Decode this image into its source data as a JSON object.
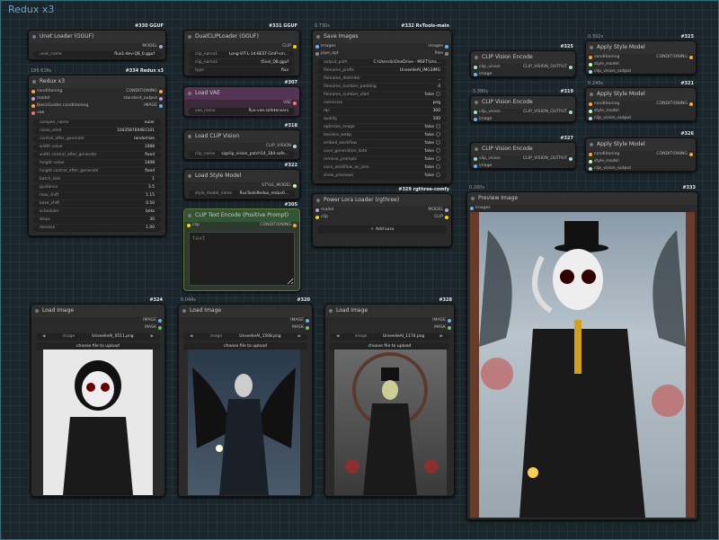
{
  "group": {
    "title": "Redux x3"
  },
  "nodes": {
    "unet": {
      "id": "#330 GGUF",
      "title": "Unet Loader (GGUF)",
      "out": "MODEL",
      "w_label": "unet_name",
      "w_value": "flux1-dev-Q8_0.gguf"
    },
    "redux": {
      "id": "#334 Redux x3",
      "time": "186.616s",
      "title": "Redux x3",
      "inputs": [
        "conditioning",
        "model",
        "BasicGuider conditioning",
        "vae"
      ],
      "outputs": [
        "CONDITIONING",
        "standard_output",
        "IMAGE"
      ],
      "widgets": [
        [
          "sampler_name",
          "euler"
        ],
        [
          "noise_seed",
          "104358760481101"
        ],
        [
          "control_after_generate",
          "randomize"
        ],
        [
          "width value",
          "1088"
        ],
        [
          "width control_after_generate",
          "fixed"
        ],
        [
          "height value",
          "1408"
        ],
        [
          "height control_after_generate",
          "fixed"
        ],
        [
          "batch_size",
          "1"
        ],
        [
          "guidance",
          "3.5"
        ],
        [
          "max_shift",
          "1.15"
        ],
        [
          "base_shift",
          "0.50"
        ],
        [
          "scheduler",
          "beta"
        ],
        [
          "steps",
          "30"
        ],
        [
          "denoise",
          "1.00"
        ]
      ]
    },
    "dualclip": {
      "id": "#331 GGUF",
      "title": "DualCLIPLoader (GGUF)",
      "out": "CLIP",
      "widgets": [
        [
          "clip_name1",
          "Long-ViT-L-14-BEST-GmP-sm..."
        ],
        [
          "clip_name2",
          "t5xxl_Q8.gguf"
        ],
        [
          "type",
          "flux"
        ]
      ]
    },
    "vae": {
      "id": "#307",
      "title": "Load VAE",
      "out": "VAE",
      "w_label": "vae_name",
      "w_value": "flux-vae.safetensors"
    },
    "clipvision": {
      "id": "#318",
      "title": "Load CLIP Vision",
      "out": "CLIP_VISION",
      "w_label": "clip_name",
      "w_value": "sigclip_vision_patch14_384.safe..."
    },
    "stylemodel": {
      "id": "#322",
      "title": "Load Style Model",
      "out": "STYLE_MODEL",
      "w_label": "style_model_name",
      "w_value": "fluxToolsRedux_redux0..."
    },
    "clipenc": {
      "id": "#305",
      "title": "CLIP Text Encode (Positive Prompt)",
      "in": "clip",
      "out": "CONDITIONING",
      "placeholder": "text"
    },
    "save": {
      "id": "#332 RvTools-main",
      "time": "0.730s",
      "title": "Save Images",
      "inputs": [
        "images",
        "pipe_opt"
      ],
      "outputs": [
        "images",
        "files"
      ],
      "widgets": [
        [
          "output_path",
          "C:\\Users\\k\\OneDrive - MSFT\\Uns..."
        ],
        [
          "filename_prefix",
          "UnseelieAI_IMG3IMG"
        ],
        [
          "filename_delimiter",
          "_"
        ],
        [
          "filename_number_padding",
          "4"
        ],
        [
          "filename_number_start",
          "false"
        ],
        [
          "extension",
          "png"
        ],
        [
          "dpi",
          "300"
        ],
        [
          "quality",
          "100"
        ],
        [
          "optimize_image",
          "false"
        ],
        [
          "lossless_webp",
          "false"
        ],
        [
          "embed_workflow",
          "false"
        ],
        [
          "save_generation_data",
          "false"
        ],
        [
          "remove_prompts",
          "false"
        ],
        [
          "save_workflow_as_json",
          "false"
        ],
        [
          "show_previews",
          "false"
        ]
      ]
    },
    "lora": {
      "id": "#329 rgthree-comfy",
      "title": "Power Lora Loader (rgthree)",
      "inputs": [
        "model",
        "clip"
      ],
      "outputs": [
        "MODEL",
        "CLIP"
      ],
      "button": "Add Lora"
    },
    "cve1": {
      "id": "#325",
      "title": "CLIP Vision Encode",
      "inputs": [
        "clip_vision",
        "image"
      ],
      "out": "CLIP_VISION_OUTPUT"
    },
    "cve2": {
      "id": "#319",
      "time": "0.380s",
      "title": "CLIP Vision Encode",
      "inputs": [
        "clip_vision",
        "image"
      ],
      "out": "CLIP_VISION_OUTPUT"
    },
    "cve3": {
      "id": "#327",
      "title": "CLIP Vision Encode",
      "inputs": [
        "clip_vision",
        "image"
      ],
      "out": "CLIP_VISION_OUTPUT"
    },
    "asm1": {
      "id": "#323",
      "time": "0.302s",
      "title": "Apply Style Model",
      "inputs": [
        "conditioning",
        "style_model",
        "clip_vision_output"
      ],
      "out": "CONDITIONING"
    },
    "asm2": {
      "id": "#321",
      "time": "0.249s",
      "title": "Apply Style Model",
      "inputs": [
        "conditioning",
        "style_model",
        "clip_vision_output"
      ],
      "out": "CONDITIONING"
    },
    "asm3": {
      "id": "#326",
      "title": "Apply Style Model",
      "inputs": [
        "conditioning",
        "style_model",
        "clip_vision_output"
      ],
      "out": "CONDITIONING"
    },
    "preview": {
      "id": "#333",
      "time": "0.200s",
      "title": "Preview Image",
      "in": "images"
    },
    "img1": {
      "id": "#324",
      "title": "Load Image",
      "outputs": [
        "IMAGE",
        "MASK"
      ],
      "w_label": "image",
      "w_value": "UnseelieAI_0511.png",
      "upload": "choose file to upload"
    },
    "img2": {
      "id": "#320",
      "time": "0.044s",
      "title": "Load Image",
      "outputs": [
        "IMAGE",
        "MASK"
      ],
      "w_label": "image",
      "w_value": "UnseelieAI_1508.png",
      "upload": "choose file to upload"
    },
    "img3": {
      "id": "#328",
      "title": "Load Image",
      "outputs": [
        "IMAGE",
        "MASK"
      ],
      "w_label": "image",
      "w_value": "UnseelieAI_1174.png",
      "upload": "choose file to upload"
    }
  },
  "colors": {
    "model": "#b39ddb",
    "conditioning": "#ffa931",
    "image": "#64b5f6",
    "vae": "#ff6e6e",
    "clip": "#ffd500",
    "clip_vision": "#a8dadc",
    "style": "#c2ffae",
    "vae_node": "#553355",
    "clip_node": "#335533"
  },
  "icons": [
    "chevron-left-icon",
    "chevron-right-icon",
    "plus-icon",
    "toggle-icon"
  ]
}
